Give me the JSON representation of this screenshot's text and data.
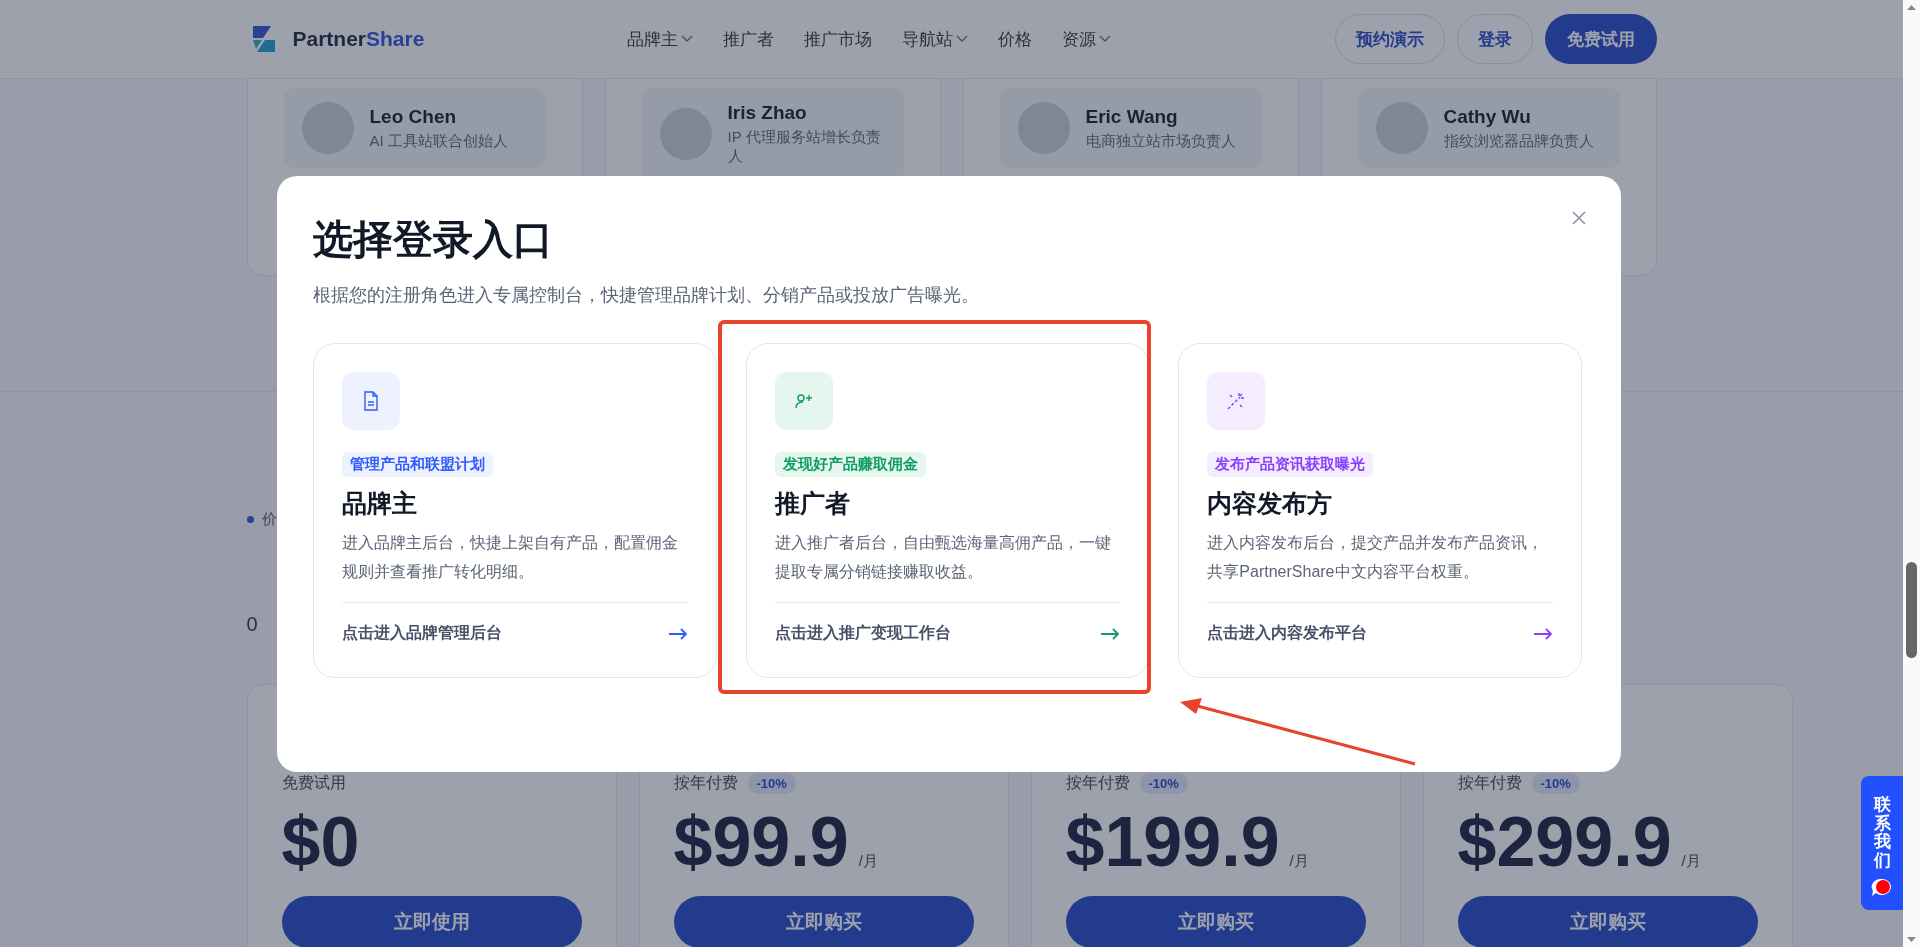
{
  "header": {
    "brand": {
      "first": "Partner",
      "second": "Share"
    },
    "nav": [
      {
        "label": "品牌主",
        "dropdown": true
      },
      {
        "label": "推广者",
        "dropdown": false
      },
      {
        "label": "推广市场",
        "dropdown": false
      },
      {
        "label": "导航站",
        "dropdown": true
      },
      {
        "label": "价格",
        "dropdown": false
      },
      {
        "label": "资源",
        "dropdown": true
      }
    ],
    "buttons": [
      {
        "label": "预约演示",
        "kind": "outline"
      },
      {
        "label": "登录",
        "kind": "outline"
      },
      {
        "label": "免费试用",
        "kind": "primary"
      }
    ]
  },
  "testimonials": [
    {
      "name": "Leo Chen",
      "role": "AI 工具站联合创始人"
    },
    {
      "name": "Iris Zhao",
      "role": "IP 代理服务站增长负责人"
    },
    {
      "name": "Eric Wang",
      "role": "电商独立站市场负责人"
    },
    {
      "name": "Cathy Wu",
      "role": "指纹浏览器品牌负责人"
    }
  ],
  "pricing": {
    "eyebrow": "价",
    "subtitle": "0",
    "plans": [
      {
        "label": "免费试用",
        "price": "$0",
        "button": "立即使用"
      },
      {
        "label": "按年付费",
        "discount": "-10%",
        "price": "$99.9",
        "unit": "/月",
        "button": "立即购买"
      },
      {
        "label": "按年付费",
        "discount": "-10%",
        "price": "$199.9",
        "unit": "/月",
        "button": "立即购买"
      },
      {
        "label": "按年付费",
        "discount": "-10%",
        "price": "$299.9",
        "unit": "/月",
        "button": "立即购买"
      }
    ]
  },
  "modal": {
    "title": "选择登录入口",
    "subtitle": "根据您的注册角色进入专属控制台，快捷管理品牌计划、分销产品或投放广告曝光。",
    "roles": [
      {
        "kind": "brand",
        "color": "#2f5bff",
        "tag": "管理产品和联盟计划",
        "title": "品牌主",
        "description": "进入品牌主后台，快捷上架自有产品，配置佣金规则并查看推广转化明细。",
        "link": "点击进入品牌管理后台"
      },
      {
        "kind": "promoter",
        "color": "#0f9d63",
        "tag": "发现好产品赚取佣金",
        "title": "推广者",
        "description": "进入推广者后台，自由甄选海量高佣产品，一键提取专属分销链接赚取收益。",
        "link": "点击进入推广变现工作台"
      },
      {
        "kind": "publisher",
        "color": "#8a3ffc",
        "tag": "发布产品资讯获取曝光",
        "title": "内容发布方",
        "description": "进入内容发布后台，提交产品并发布产品资讯，共享PartnerShare中文内容平台权重。",
        "link": "点击进入内容发布平台"
      }
    ]
  },
  "contact_tab": {
    "label": "联系我们"
  }
}
